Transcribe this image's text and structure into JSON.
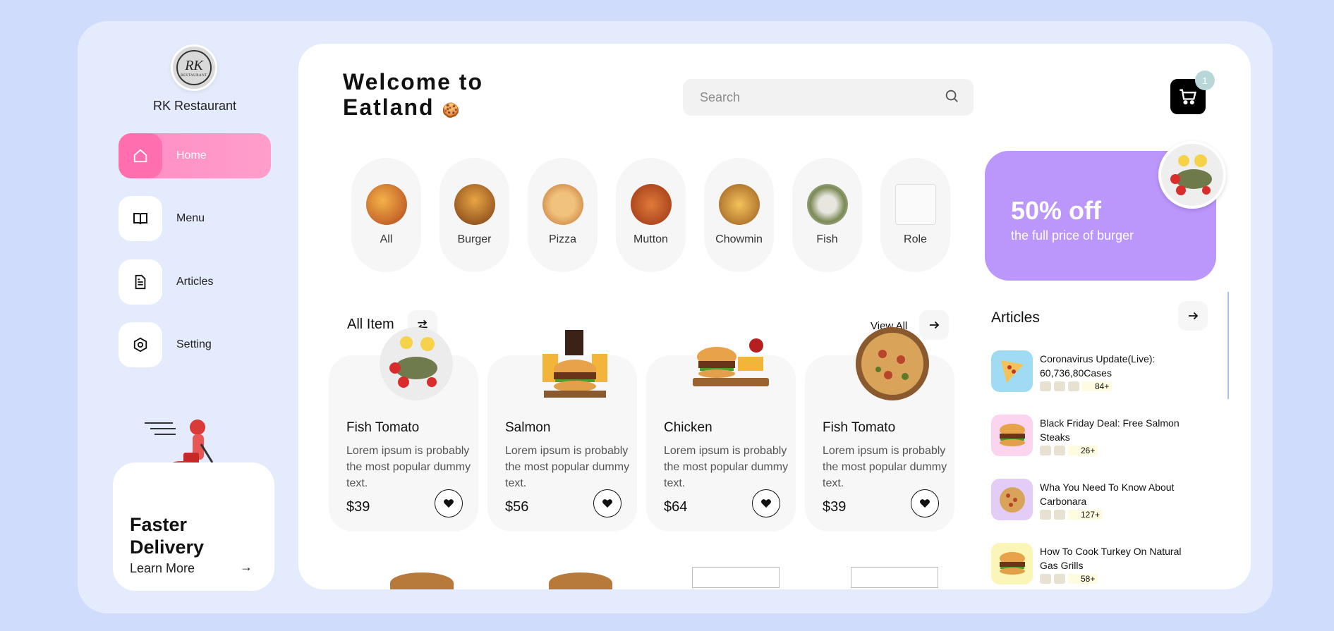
{
  "sidebar": {
    "brand": "RK Restaurant",
    "logo_mono": "RK",
    "logo_sub": "RESTAURANT",
    "nav": [
      {
        "label": "Home",
        "icon": "home-icon",
        "active": true
      },
      {
        "label": "Menu",
        "icon": "book-icon",
        "active": false
      },
      {
        "label": "Articles",
        "icon": "document-icon",
        "active": false
      },
      {
        "label": "Setting",
        "icon": "gear-icon",
        "active": false
      }
    ],
    "delivery": {
      "title": "Faster Delivery",
      "link": "Learn More"
    }
  },
  "header": {
    "welcome_line1": "Welcome to",
    "welcome_line2": "Eatland",
    "search_placeholder": "Search",
    "cart_count": "1"
  },
  "categories": [
    "All",
    "Burger",
    "Pizza",
    "Mutton",
    "Chowmin",
    "Fish",
    "Role"
  ],
  "promo": {
    "headline": "50% off",
    "subtext": "the full price of burger"
  },
  "items_section": {
    "title": "All Item",
    "view_all": "View All"
  },
  "items": [
    {
      "title": "Fish Tomato",
      "desc": "Lorem ipsum is probably the most popular dummy text.",
      "price": "$39"
    },
    {
      "title": "Salmon",
      "desc": "Lorem ipsum is probably the most popular dummy text.",
      "price": "$56"
    },
    {
      "title": "Chicken",
      "desc": "Lorem ipsum is probably the most popular dummy text.",
      "price": "$64"
    },
    {
      "title": "Fish Tomato",
      "desc": "Lorem ipsum is probably the most popular dummy text.",
      "price": "$39"
    }
  ],
  "articles": {
    "title": "Articles",
    "list": [
      {
        "title": "Coronavirus Update(Live): 60,736,80Cases",
        "count": "84+",
        "thumb_color": "#9fdcf3"
      },
      {
        "title": "Black Friday Deal: Free Salmon Steaks",
        "count": "26+",
        "thumb_color": "#fbd4ef"
      },
      {
        "title": "Wha You Need To Know About Carbonara",
        "count": "127+",
        "thumb_color": "#e3cdf7"
      },
      {
        "title": "How To Cook Turkey On Natural Gas Grills",
        "count": "58+",
        "thumb_color": "#fbf6b8"
      }
    ]
  }
}
